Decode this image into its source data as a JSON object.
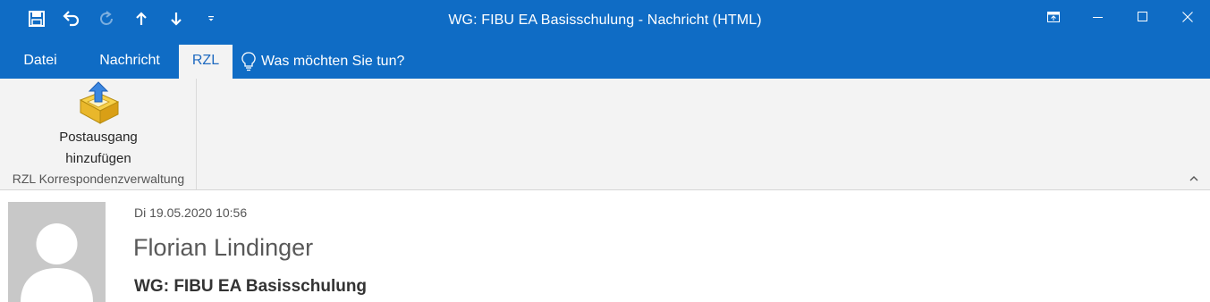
{
  "window": {
    "title": "WG: FIBU EA Basisschulung - Nachricht (HTML)"
  },
  "qat": {
    "icons": [
      "save-icon",
      "undo-icon",
      "redo-icon",
      "arrow-up-icon",
      "arrow-down-icon",
      "customize-dropdown-icon"
    ]
  },
  "tabs": [
    {
      "label": "Datei"
    },
    {
      "label": "Nachricht"
    },
    {
      "label": "RZL"
    }
  ],
  "tell_me": {
    "text": "Was möchten Sie tun?"
  },
  "ribbon": {
    "button_line1": "Postausgang",
    "button_line2": "hinzufügen",
    "group_label": "RZL Korrespondenzverwaltung"
  },
  "message": {
    "date": "Di 19.05.2020 10:56",
    "sender": "Florian Lindinger",
    "subject": "WG: FIBU EA Basisschulung"
  },
  "colors": {
    "accent": "#0f6cc5",
    "ribbon_bg": "#f3f3f3",
    "active_tab_text": "#1e6ac0"
  }
}
